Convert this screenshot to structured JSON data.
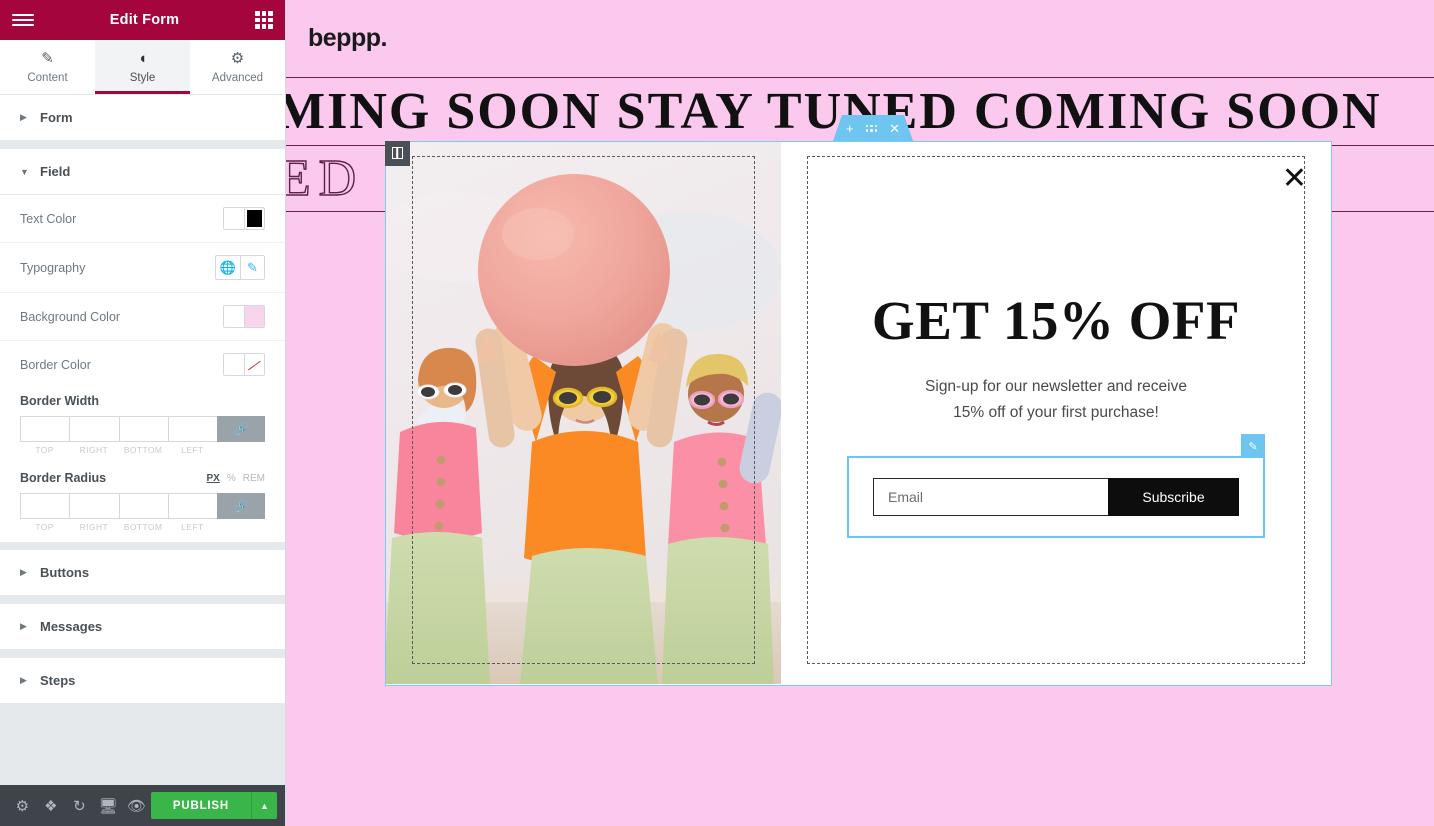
{
  "panel": {
    "header": {
      "title": "Edit Form",
      "menu_icon": "hamburger-icon",
      "apps_icon": "grid-icon"
    },
    "tabs": [
      {
        "label": "Content",
        "icon": "pencil-icon",
        "active": false
      },
      {
        "label": "Style",
        "icon": "contrast-icon",
        "active": true
      },
      {
        "label": "Advanced",
        "icon": "gear-icon",
        "active": false
      }
    ],
    "sections": [
      {
        "label": "Form",
        "expanded": false
      },
      {
        "label": "Field",
        "expanded": true
      },
      {
        "label": "Buttons",
        "expanded": false
      },
      {
        "label": "Messages",
        "expanded": false
      },
      {
        "label": "Steps",
        "expanded": false
      }
    ],
    "field_controls": {
      "text_color": {
        "label": "Text Color",
        "value": "#000000"
      },
      "typography": {
        "label": "Typography",
        "globe_icon": "globe-icon",
        "edit_icon": "pencil-icon"
      },
      "background_color": {
        "label": "Background Color",
        "value": "#f7d5ec"
      },
      "border_color": {
        "label": "Border Color",
        "value": "none"
      },
      "border_width": {
        "label": "Border Width",
        "sides": [
          "TOP",
          "RIGHT",
          "BOTTOM",
          "LEFT"
        ],
        "values": [
          "",
          "",
          "",
          ""
        ],
        "link_icon": "link-icon"
      },
      "border_radius": {
        "label": "Border Radius",
        "sides": [
          "TOP",
          "RIGHT",
          "BOTTOM",
          "LEFT"
        ],
        "values": [
          "",
          "",
          "",
          ""
        ],
        "units": [
          "PX",
          "%",
          "REM"
        ],
        "active_unit": "PX",
        "link_icon": "link-icon"
      }
    },
    "footer": {
      "icons": [
        "gear-icon",
        "layers-icon",
        "history-icon",
        "desktop-icon",
        "eye-icon"
      ],
      "publish_label": "PUBLISH",
      "publish_color": "#39b54a",
      "publish_arrow_icon": "chevron-up-icon"
    }
  },
  "canvas": {
    "brand": "beppp.",
    "marquee_solid": "COMING SOON STAY TUNED COMING SOON",
    "marquee_outline": "STAY TUNED COMING SOON COMING",
    "background_color": "#fbc8ee",
    "rule_color": "#6b2049"
  },
  "popup": {
    "section_toolbar": {
      "add_icon": "plus-icon",
      "drag_icon": "dots-grid-icon",
      "close_icon": "x-icon",
      "color": "#6ec5f0"
    },
    "column_handle_icon": "column-layout-icon",
    "close_icon": "close-icon",
    "image_alt": "three women in pink and orange tops holding a large pink balloon",
    "title": "GET 15% OFF",
    "subtitle_line1": "Sign-up for our newsletter and receive",
    "subtitle_line2": "15% off of your first purchase!",
    "form": {
      "email_placeholder": "Email",
      "email_value": "",
      "submit_label": "Subscribe",
      "submit_bg": "#0d0d0d",
      "selected_outline": "#6ec5f0",
      "edit_icon": "pencil-icon"
    }
  }
}
